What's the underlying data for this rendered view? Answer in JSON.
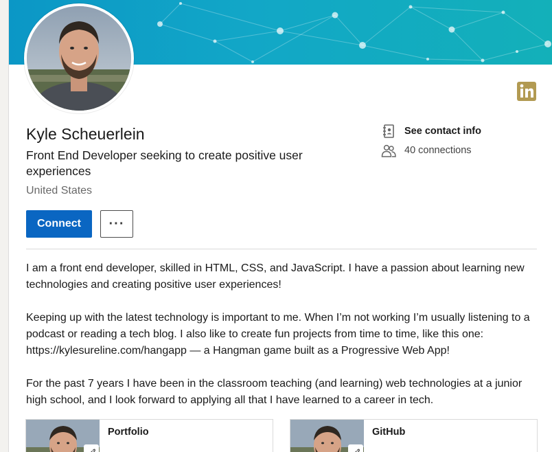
{
  "profile": {
    "name": "Kyle Scheuerlein",
    "headline": "Front End Developer seeking to create positive user experiences",
    "location": "United States"
  },
  "contact": {
    "contact_info_label": "See contact info",
    "connections_label": "40 connections"
  },
  "actions": {
    "connect_label": "Connect",
    "more_label": "···"
  },
  "about": {
    "paragraphs": [
      "I am a front end developer, skilled in HTML, CSS, and JavaScript. I have a passion about learning new technologies and creating positive user experiences!",
      "Keeping up with the latest technology is important to me. When I’m not working I’m usually listening to a podcast or reading a tech blog. I also like to create fun projects from time to time, like this one: https://kylesureline.com/hangapp — a Hangman game built as a Progressive Web App!",
      "For the past 7 years I have been in the classroom teaching (and learning) web technologies at a junior high school, and I look forward to applying all that I have learned to a career in tech."
    ]
  },
  "media": [
    {
      "title": "Portfolio"
    },
    {
      "title": "GitHub"
    }
  ],
  "icons": {
    "brand": "linkedin-icon",
    "contact": "contact-card-icon",
    "connections": "people-icon",
    "link": "link-icon"
  },
  "colors": {
    "primary": "#0a66c2",
    "banner": "#0fa3c6",
    "linkedin_logo": "#b29a52"
  }
}
